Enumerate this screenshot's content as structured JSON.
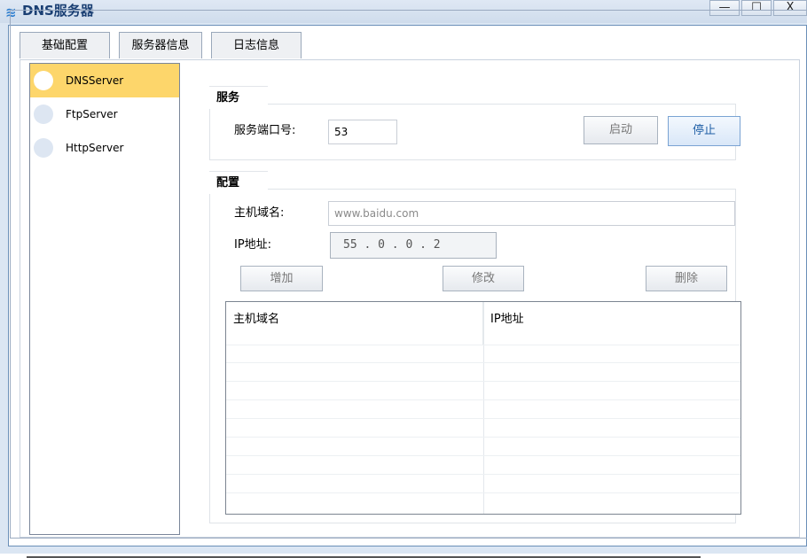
{
  "window": {
    "title": "DNS服务器",
    "icon": "network-icon",
    "buttons": {
      "minimize": "—",
      "maximize": "☐",
      "close": "X"
    }
  },
  "tabs": [
    {
      "label": "基础配置",
      "active": false
    },
    {
      "label": "服务器信息",
      "active": false
    },
    {
      "label": "日志信息",
      "active": false
    }
  ],
  "sidebar": {
    "items": [
      {
        "label": "DNSServer",
        "selected": true
      },
      {
        "label": "FtpServer",
        "selected": false
      },
      {
        "label": "HttpServer",
        "selected": false
      }
    ]
  },
  "service": {
    "group_label": "服务",
    "port_label": "服务端口号:",
    "port_value": "53",
    "start_label": "启动",
    "stop_label": "停止"
  },
  "config": {
    "group_label": "配置",
    "host_label": "主机域名:",
    "host_placeholder": "www.baidu.com",
    "ip_label": "IP地址:",
    "ip_value": "55  .  0  .  0  .  2",
    "add_label": "增加",
    "edit_label": "修改",
    "delete_label": "删除"
  },
  "table": {
    "columns": [
      "主机域名",
      "IP地址"
    ],
    "rows": []
  },
  "colors": {
    "selected_item": "#fdd66b",
    "primary_button_text": "#1f5fa6",
    "title_text": "#1a3f73"
  }
}
